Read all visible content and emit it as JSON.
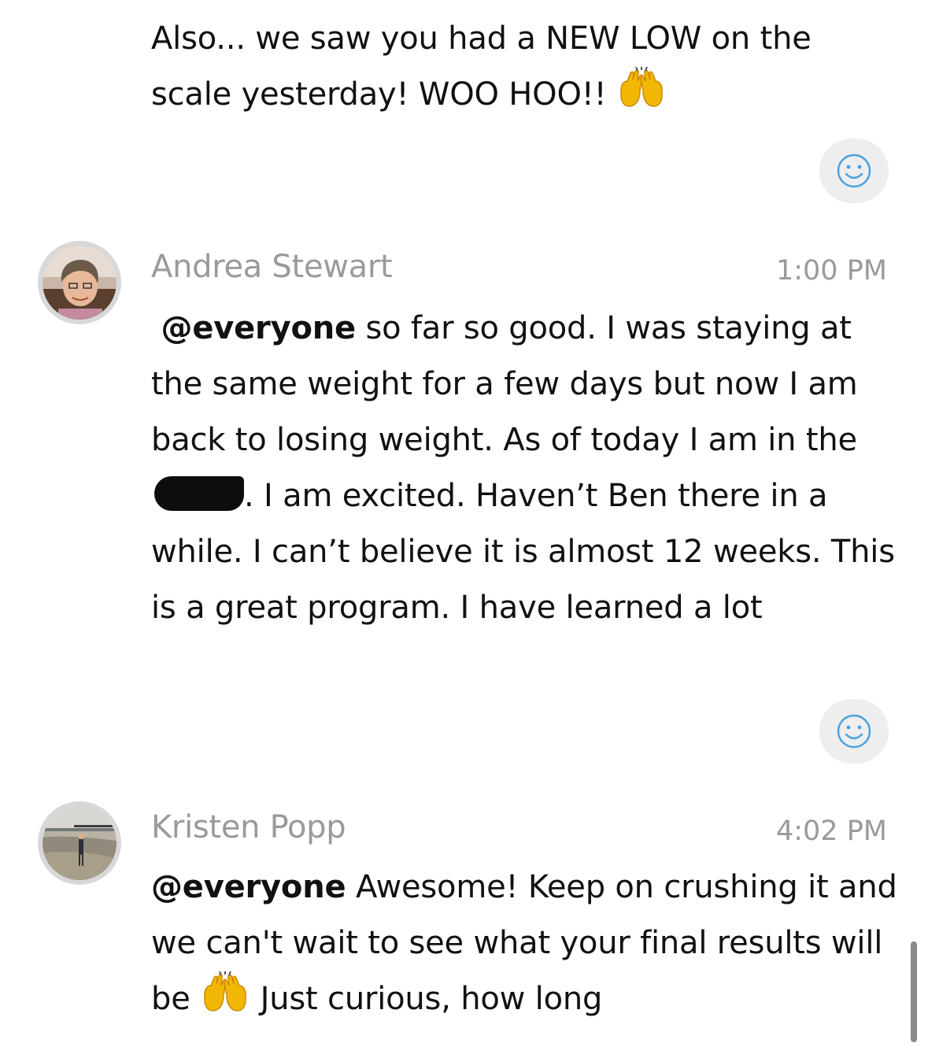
{
  "messages": [
    {
      "text_before": "Also... we saw you had a NEW LOW on the scale yesterday! WOO HOO!!",
      "emoji": "raising-hands-emoji"
    },
    {
      "author": "Andrea Stewart",
      "time": "1:00 PM",
      "mention": "@everyone",
      "text_part1": "so far so good. I was staying at the same weight for a few days but now I am back to losing weight. As of today I am in the",
      "redacted": true,
      "text_part2": ". I am excited. Haven’t Ben there in a while. I can’t believe it is almost 12 weeks. This is a great program. I have learned a lot"
    },
    {
      "author": "Kristen Popp",
      "time": "4:02 PM",
      "mention": "@everyone",
      "text_part1": "Awesome! Keep on crushing it and we can't wait to see what your final results will be",
      "emoji": "raising-hands-emoji",
      "text_part2": "Just curious, how long"
    }
  ],
  "icons": {
    "reaction": "smiley-icon",
    "reaction_color": "#4aa3df"
  }
}
